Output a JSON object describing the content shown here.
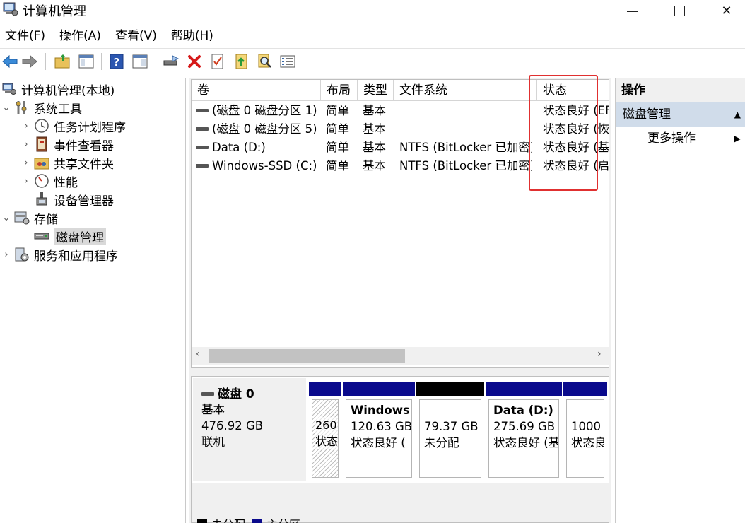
{
  "window": {
    "title": "计算机管理",
    "min_glyph": "",
    "close_glyph": "✕"
  },
  "menu": [
    "文件(F)",
    "操作(A)",
    "查看(V)",
    "帮助(H)"
  ],
  "tree": [
    {
      "label": "计算机管理(本地)",
      "icon": "computer-management-icon",
      "level": 0,
      "chevron": ""
    },
    {
      "label": "系统工具",
      "icon": "system-tools-icon",
      "level": 0,
      "chevron": "⌄"
    },
    {
      "label": "任务计划程序",
      "icon": "task-scheduler-icon",
      "level": 1,
      "chevron": "›"
    },
    {
      "label": "事件查看器",
      "icon": "event-viewer-icon",
      "level": 1,
      "chevron": "›"
    },
    {
      "label": "共享文件夹",
      "icon": "shared-folders-icon",
      "level": 1,
      "chevron": "›"
    },
    {
      "label": "性能",
      "icon": "performance-icon",
      "level": 1,
      "chevron": "›"
    },
    {
      "label": "设备管理器",
      "icon": "device-manager-icon",
      "level": 1,
      "chevron": ""
    },
    {
      "label": "存储",
      "icon": "storage-icon",
      "level": 0,
      "chevron": "⌄"
    },
    {
      "label": "磁盘管理",
      "icon": "disk-management-icon",
      "level": 1,
      "chevron": "",
      "selected": true
    },
    {
      "label": "服务和应用程序",
      "icon": "services-apps-icon",
      "level": 0,
      "chevron": "›"
    }
  ],
  "columns": [
    "卷",
    "布局",
    "类型",
    "文件系统",
    "状态"
  ],
  "volumes": [
    {
      "name": "(磁盘 0 磁盘分区 1)",
      "layout": "简单",
      "type": "基本",
      "fs": "",
      "status": "状态良好 (EF"
    },
    {
      "name": "(磁盘 0 磁盘分区 5)",
      "layout": "简单",
      "type": "基本",
      "fs": "",
      "status": "状态良好 (恢"
    },
    {
      "name": "Data (D:)",
      "layout": "简单",
      "type": "基本",
      "fs": "NTFS (BitLocker 已加密)",
      "status": "状态良好 (基"
    },
    {
      "name": "Windows-SSD (C:)",
      "layout": "简单",
      "type": "基本",
      "fs": "NTFS (BitLocker 已加密)",
      "status": "状态良好 (启"
    }
  ],
  "disk": {
    "title": "磁盘 0",
    "kind": "基本",
    "size": "476.92 GB",
    "state": "联机"
  },
  "partitions": [
    {
      "name": "",
      "size": "260",
      "status": "状态",
      "bar_color": "#0a0a8c",
      "hatched": true
    },
    {
      "name": "Windows",
      "size": "120.63 GB",
      "status": "状态良好 (",
      "bar_color": "#0a0a8c",
      "hatched": false
    },
    {
      "name": "",
      "size": "79.37 GB",
      "status": "未分配",
      "bar_color": "#000000",
      "hatched": false
    },
    {
      "name": "Data  (D:)",
      "size": "275.69 GB",
      "status": "状态良好 (基",
      "bar_color": "#0a0a8c",
      "hatched": false
    },
    {
      "name": "",
      "size": "1000",
      "status": "状态良",
      "bar_color": "#0a0a8c",
      "hatched": false
    }
  ],
  "legend": [
    {
      "label": "未分配",
      "color": "#000000"
    },
    {
      "label": "主分区",
      "color": "#0a0a8c"
    }
  ],
  "actions": {
    "header": "操作",
    "section": "磁盘管理",
    "item": "更多操作"
  },
  "colors": {
    "highlight": "#e03030",
    "section_bg": "#d0dcea",
    "partition_primary": "#0a0a8c"
  }
}
